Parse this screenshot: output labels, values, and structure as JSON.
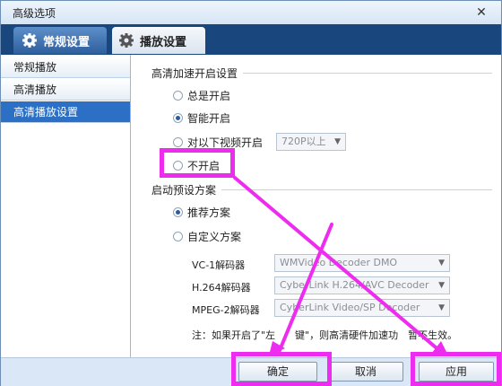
{
  "window": {
    "title": "高级选项",
    "close_glyph": "✕"
  },
  "tabs": [
    {
      "label": "常规设置",
      "icon": "gear-icon"
    },
    {
      "label": "播放设置",
      "icon": "gear-icon"
    }
  ],
  "sidebar": {
    "items": [
      {
        "label": "常规播放"
      },
      {
        "label": "高清播放"
      },
      {
        "label": "高清播放设置",
        "selected": true
      }
    ]
  },
  "hd_accel": {
    "heading": "高清加速开启设置",
    "options": [
      {
        "label": "总是开启",
        "checked": false
      },
      {
        "label": "智能开启",
        "checked": true
      },
      {
        "label": "对以下视频开启",
        "checked": false
      },
      {
        "label": "不开启",
        "checked": false
      }
    ],
    "threshold_value": "720P以上"
  },
  "preset": {
    "heading": "启动预设方案",
    "options": [
      {
        "label": "推荐方案",
        "checked": true
      },
      {
        "label": "自定义方案",
        "checked": false
      }
    ],
    "decoders": [
      {
        "label": "VC-1解码器",
        "value": "WMVideo Decoder DMO"
      },
      {
        "label": "H.264解码器",
        "value": "CyberLink H.264/AVC Decoder"
      },
      {
        "label": "MPEG-2解码器",
        "value": "CyberLink Video/SP Decoder"
      }
    ],
    "note": "注：如果开启了\"左　　键\"，则高清硬件加速功　暂不生效。"
  },
  "buttons": {
    "ok": "确定",
    "cancel": "取消",
    "apply": "应用"
  },
  "colors": {
    "highlight": "#ee2cf0",
    "tab_bar": "#19467d",
    "selected": "#2b70c4"
  }
}
